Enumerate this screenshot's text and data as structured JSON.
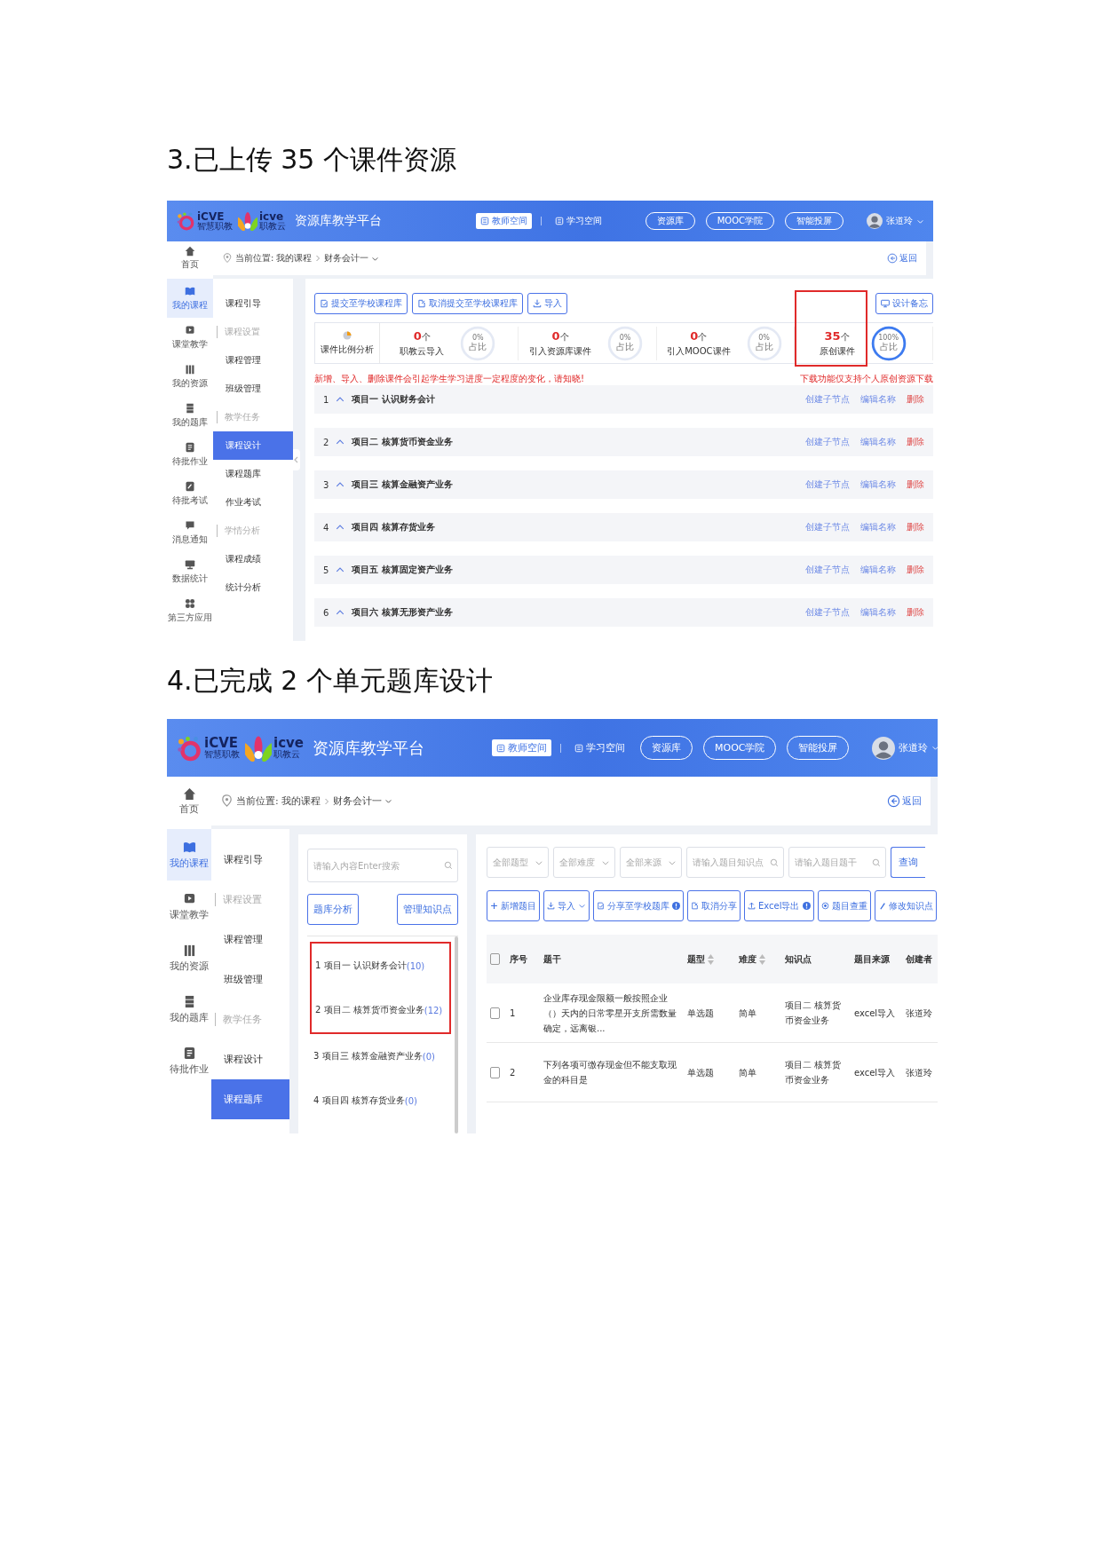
{
  "sections": [
    {
      "heading": "3.已上传 35 个课件资源",
      "screen": {
        "kind": "courseware",
        "header": {
          "logos": [
            {
              "mark": "iCVE",
              "sub": "智慧职教"
            },
            {
              "mark": "icve",
              "sub": "职教云"
            }
          ],
          "title": "资源库教学平台",
          "nav": [
            {
              "label": "教师空间",
              "selected": true
            },
            {
              "label": "学习空间",
              "selected": false
            }
          ],
          "pills": [
            "资源库",
            "MOOC学院",
            "智能投屏"
          ],
          "user": "张道玲"
        },
        "breadcrumb": {
          "home": "首页",
          "prefix": "当前位置:",
          "path": [
            "我的课程",
            "财务会计一"
          ],
          "back": "返回"
        },
        "sidebar": [
          {
            "label": "我的课程",
            "selected": true
          },
          {
            "label": "课堂教学",
            "selected": false
          },
          {
            "label": "我的资源",
            "selected": false
          },
          {
            "label": "我的题库",
            "selected": false
          },
          {
            "label": "待批作业",
            "selected": false
          },
          {
            "label": "待批考试",
            "selected": false
          },
          {
            "label": "消息通知",
            "selected": false
          },
          {
            "label": "数据统计",
            "selected": false
          },
          {
            "label": "第三方应用",
            "selected": false
          }
        ],
        "submenu": [
          {
            "kind": "item",
            "label": "课程引导",
            "selected": false
          },
          {
            "kind": "group",
            "label": "课程设置",
            "selected": false
          },
          {
            "kind": "item",
            "label": "课程管理",
            "selected": false
          },
          {
            "kind": "item",
            "label": "班级管理",
            "selected": false
          },
          {
            "kind": "group",
            "label": "教学任务",
            "selected": false
          },
          {
            "kind": "item",
            "label": "课程设计",
            "selected": true
          },
          {
            "kind": "item",
            "label": "课程题库",
            "selected": false
          },
          {
            "kind": "item",
            "label": "作业考试",
            "selected": false
          },
          {
            "kind": "group",
            "label": "学情分析",
            "selected": false
          },
          {
            "kind": "item",
            "label": "课程成绩",
            "selected": false
          },
          {
            "kind": "item",
            "label": "统计分析",
            "selected": false
          }
        ],
        "content": {
          "actions": [
            "提交至学校课程库",
            "取消提交至学校课程库",
            "导入"
          ],
          "memo": "设计备忘",
          "analysis_label": "课件比例分析",
          "stats": [
            {
              "value": "0",
              "unit": "个",
              "label": "职教云导入",
              "percent": "0%",
              "percent_label": "占比",
              "level": 0,
              "highlighted": false
            },
            {
              "value": "0",
              "unit": "个",
              "label": "引入资源库课件",
              "percent": "0%",
              "percent_label": "占比",
              "level": 0,
              "highlighted": false
            },
            {
              "value": "0",
              "unit": "个",
              "label": "引入MOOC课件",
              "percent": "0%",
              "percent_label": "占比",
              "level": 0,
              "highlighted": false
            },
            {
              "value": "35",
              "unit": "个",
              "label": "原创课件",
              "percent": "100%",
              "percent_label": "占比",
              "level": 1,
              "highlighted": true
            }
          ],
          "warning": "新增、导入、删除课件会引起学生学习进度一定程度的变化，请知晓!",
          "notice": "下载功能仅支持个人原创资源下载",
          "chapters": [
            {
              "index": "1",
              "title": "项目一 认识财务会计",
              "actions": [
                {
                  "label": "创建子节点",
                  "kind": "link"
                },
                {
                  "label": "编辑名称",
                  "kind": "link"
                },
                {
                  "label": "删除",
                  "kind": "danger"
                }
              ]
            },
            {
              "index": "2",
              "title": "项目二 核算货币资金业务",
              "actions": [
                {
                  "label": "创建子节点",
                  "kind": "link"
                },
                {
                  "label": "编辑名称",
                  "kind": "link"
                },
                {
                  "label": "删除",
                  "kind": "danger"
                }
              ]
            },
            {
              "index": "3",
              "title": "项目三 核算金融资产业务",
              "actions": [
                {
                  "label": "创建子节点",
                  "kind": "link"
                },
                {
                  "label": "编辑名称",
                  "kind": "link"
                },
                {
                  "label": "删除",
                  "kind": "danger"
                }
              ]
            },
            {
              "index": "4",
              "title": "项目四 核算存货业务",
              "actions": [
                {
                  "label": "创建子节点",
                  "kind": "link"
                },
                {
                  "label": "编辑名称",
                  "kind": "link"
                },
                {
                  "label": "删除",
                  "kind": "danger"
                }
              ]
            },
            {
              "index": "5",
              "title": "项目五 核算固定资产业务",
              "actions": [
                {
                  "label": "创建子节点",
                  "kind": "link"
                },
                {
                  "label": "编辑名称",
                  "kind": "link"
                },
                {
                  "label": "删除",
                  "kind": "danger"
                }
              ]
            },
            {
              "index": "6",
              "title": "项目六 核算无形资产业务",
              "actions": [
                {
                  "label": "创建子节点",
                  "kind": "link"
                },
                {
                  "label": "编辑名称",
                  "kind": "link"
                },
                {
                  "label": "删除",
                  "kind": "danger"
                }
              ]
            }
          ]
        }
      }
    },
    {
      "heading": "4.已完成 2 个单元题库设计",
      "screen": {
        "kind": "question_bank",
        "header": {
          "logos": [
            {
              "mark": "iCVE",
              "sub": "智慧职教"
            },
            {
              "mark": "icve",
              "sub": "职教云"
            }
          ],
          "title": "资源库教学平台",
          "nav": [
            {
              "label": "教师空间",
              "selected": true
            },
            {
              "label": "学习空间",
              "selected": false
            }
          ],
          "pills": [
            "资源库",
            "MOOC学院",
            "智能投屏"
          ],
          "user": "张道玲"
        },
        "breadcrumb": {
          "home": "首页",
          "prefix": "当前位置:",
          "path": [
            "我的课程",
            "财务会计一"
          ],
          "back": "返回"
        },
        "sidebar": [
          {
            "label": "我的课程",
            "selected": true
          },
          {
            "label": "课堂教学",
            "selected": false
          },
          {
            "label": "我的资源",
            "selected": false
          },
          {
            "label": "我的题库",
            "selected": false
          },
          {
            "label": "待批作业",
            "selected": false
          }
        ],
        "submenu": [
          {
            "kind": "item",
            "label": "课程引导",
            "selected": false
          },
          {
            "kind": "group",
            "label": "课程设置",
            "selected": false
          },
          {
            "kind": "item",
            "label": "课程管理",
            "selected": false
          },
          {
            "kind": "item",
            "label": "班级管理",
            "selected": false
          },
          {
            "kind": "group",
            "label": "教学任务",
            "selected": false
          },
          {
            "kind": "item",
            "label": "课程设计",
            "selected": false
          },
          {
            "kind": "item",
            "label": "课程题库",
            "selected": true
          }
        ],
        "content": {
          "tree": {
            "search_placeholder": "请输入内容Enter搜索",
            "buttons": [
              "题库分析",
              "管理知识点"
            ],
            "items": [
              {
                "label": "1 项目一 认识财务会计",
                "count": "(10)",
                "highlighted": true
              },
              {
                "label": "2 项目二 核算货币资金业务",
                "count": "(12)",
                "highlighted": true
              },
              {
                "label": "3 项目三 核算金融资产业务",
                "count": "(0)",
                "highlighted": false
              },
              {
                "label": "4 项目四 核算存货业务",
                "count": "(0)",
                "highlighted": false
              }
            ]
          },
          "filters": [
            {
              "kind": "select",
              "placeholder": "全部题型"
            },
            {
              "kind": "select",
              "placeholder": "全部难度"
            },
            {
              "kind": "select",
              "placeholder": "全部来源"
            },
            {
              "kind": "search",
              "placeholder": "请输入题目知识点"
            },
            {
              "kind": "search",
              "placeholder": "请输入题目题干"
            }
          ],
          "query_button": "查询",
          "toolbar": [
            {
              "label": "新增题目",
              "dropdown": false,
              "help": false
            },
            {
              "label": "导入",
              "dropdown": true,
              "help": false
            },
            {
              "label": "分享至学校题库",
              "dropdown": false,
              "help": true
            },
            {
              "label": "取消分享",
              "dropdown": false,
              "help": false
            },
            {
              "label": "Excel导出",
              "dropdown": false,
              "help": true
            },
            {
              "label": "题目查重",
              "dropdown": false,
              "help": false
            },
            {
              "label": "修改知识点",
              "dropdown": false,
              "help": false
            }
          ],
          "table": {
            "select_all_checked": false,
            "columns": [
              {
                "label": "序号",
                "sortable": false
              },
              {
                "label": "题干",
                "sortable": false
              },
              {
                "label": "题型",
                "sortable": true
              },
              {
                "label": "难度",
                "sortable": true
              },
              {
                "label": "知识点",
                "sortable": false
              },
              {
                "label": "题目来源",
                "sortable": false
              },
              {
                "label": "创建者",
                "sortable": false
              }
            ],
            "rows": [
              {
                "checked": false,
                "cells": [
                  "1",
                  "企业库存现金限额一般按照企业（）天内的日常零星开支所需数量确定，远离银...",
                  "单选题",
                  "简单",
                  "项目二 核算货币资金业务",
                  "excel导入",
                  "张道玲"
                ]
              },
              {
                "checked": false,
                "cells": [
                  "2",
                  "下列各项可缴存现金但不能支取现金的科目是",
                  "单选题",
                  "简单",
                  "项目二 核算货币资金业务",
                  "excel导入",
                  "张道玲"
                ]
              }
            ]
          }
        }
      }
    }
  ]
}
